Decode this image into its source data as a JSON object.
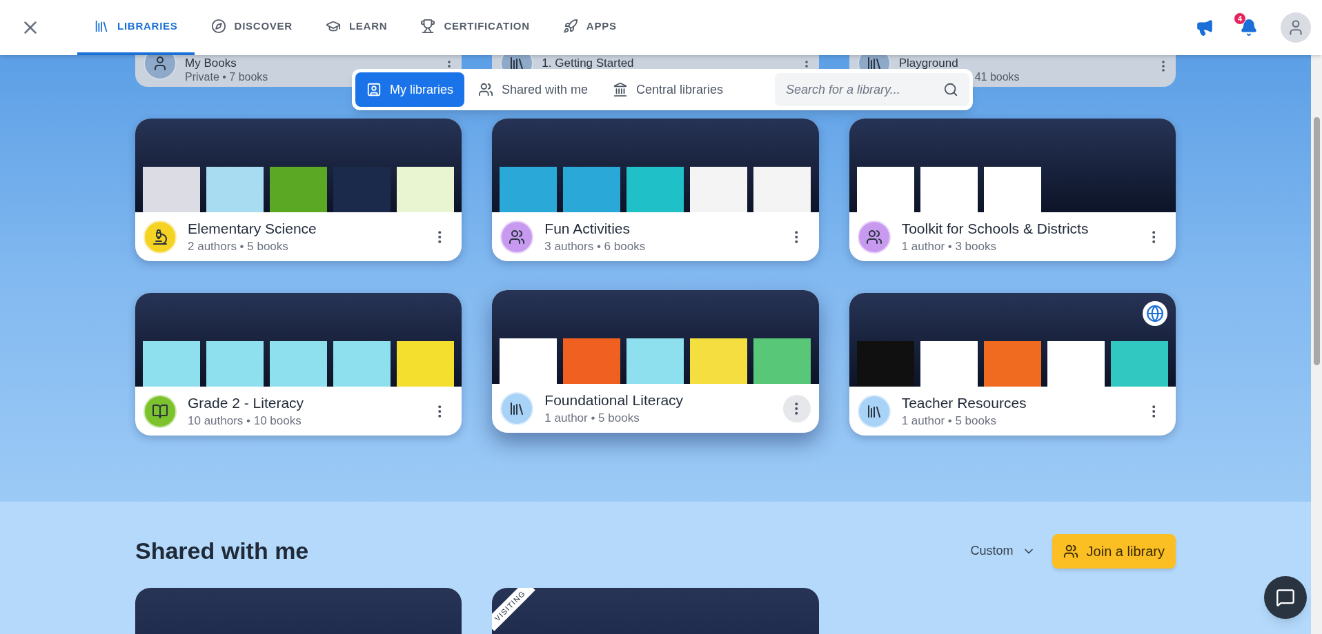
{
  "nav": {
    "tabs": [
      {
        "label": "LIBRARIES",
        "selected": true
      },
      {
        "label": "DISCOVER",
        "selected": false
      },
      {
        "label": "LEARN",
        "selected": false
      },
      {
        "label": "CERTIFICATION",
        "selected": false
      },
      {
        "label": "APPS",
        "selected": false
      }
    ],
    "notification_badge": "4"
  },
  "background_cards": [
    {
      "title": "My Books",
      "subtitle": "Private • 7 books",
      "kind": "person"
    },
    {
      "title": "1. Getting Started",
      "kind": "library"
    },
    {
      "title": "Playground",
      "subtitle": "41 books",
      "kind": "library"
    }
  ],
  "filter": {
    "tabs": [
      {
        "label": "My libraries",
        "selected": true
      },
      {
        "label": "Shared with me",
        "selected": false
      },
      {
        "label": "Central libraries",
        "selected": false
      }
    ],
    "search": {
      "placeholder": "Search for a library..."
    }
  },
  "libraries": [
    {
      "title": "Elementary Science",
      "subtitle": "2 authors • 5 books",
      "kind": "microscope",
      "color": "#f5d323",
      "hovered": false,
      "public": false,
      "covers": [
        {
          "color": "#dcdce4"
        },
        {
          "color": "#a8dcf0"
        },
        {
          "color": "#5aa823"
        },
        {
          "color": "#1b2a4a"
        },
        {
          "color": "#e8f5d0"
        }
      ]
    },
    {
      "title": "Fun Activities",
      "subtitle": "3 authors • 6 books",
      "kind": "people",
      "color": "#c79af0",
      "hovered": false,
      "public": false,
      "covers": [
        {
          "color": "#2aa9d9"
        },
        {
          "color": "#2aa9d9"
        },
        {
          "color": "#20c0c8"
        },
        {
          "color": "#f4f4f4"
        },
        {
          "color": "#f4f4f4"
        }
      ]
    },
    {
      "title": "Toolkit for Schools & Districts",
      "subtitle": "1 author • 3 books",
      "kind": "people",
      "color": "#c79af0",
      "hovered": false,
      "public": false,
      "covers": [
        {
          "color": "#ffffff"
        },
        {
          "color": "#ffffff"
        },
        {
          "color": "#ffffff"
        }
      ]
    },
    {
      "title": "Grade 2 - Literacy",
      "subtitle": "10 authors • 10 books",
      "kind": "book",
      "color": "#7cc22c",
      "hovered": false,
      "public": false,
      "covers": [
        {
          "color": "#8fe0ee"
        },
        {
          "color": "#8fe0ee"
        },
        {
          "color": "#8fe0ee"
        },
        {
          "color": "#8fe0ee"
        },
        {
          "color": "#f4de2e"
        }
      ]
    },
    {
      "title": "Foundational Literacy",
      "subtitle": "1 author • 5 books",
      "kind": "library",
      "color": "#a9d2f7",
      "hovered": true,
      "public": false,
      "covers": [
        {
          "color": "#ffffff"
        },
        {
          "color": "#f06020"
        },
        {
          "color": "#8fe0ee"
        },
        {
          "color": "#f4de40"
        },
        {
          "color": "#58c878"
        }
      ]
    },
    {
      "title": "Teacher Resources",
      "subtitle": "1 author • 5 books",
      "kind": "library",
      "color": "#a9d2f7",
      "hovered": false,
      "public": true,
      "covers": [
        {
          "color": "#101010"
        },
        {
          "color": "#ffffff"
        },
        {
          "color": "#f06a20"
        },
        {
          "color": "#ffffff"
        },
        {
          "color": "#30c8c0"
        }
      ]
    }
  ],
  "shared": {
    "title": "Shared with me",
    "sort": "Custom",
    "join_button": "Join a library",
    "cards": [
      {
        "kind": "plain"
      },
      {
        "kind": "ribbon",
        "ribbon": "VISITING"
      }
    ]
  }
}
